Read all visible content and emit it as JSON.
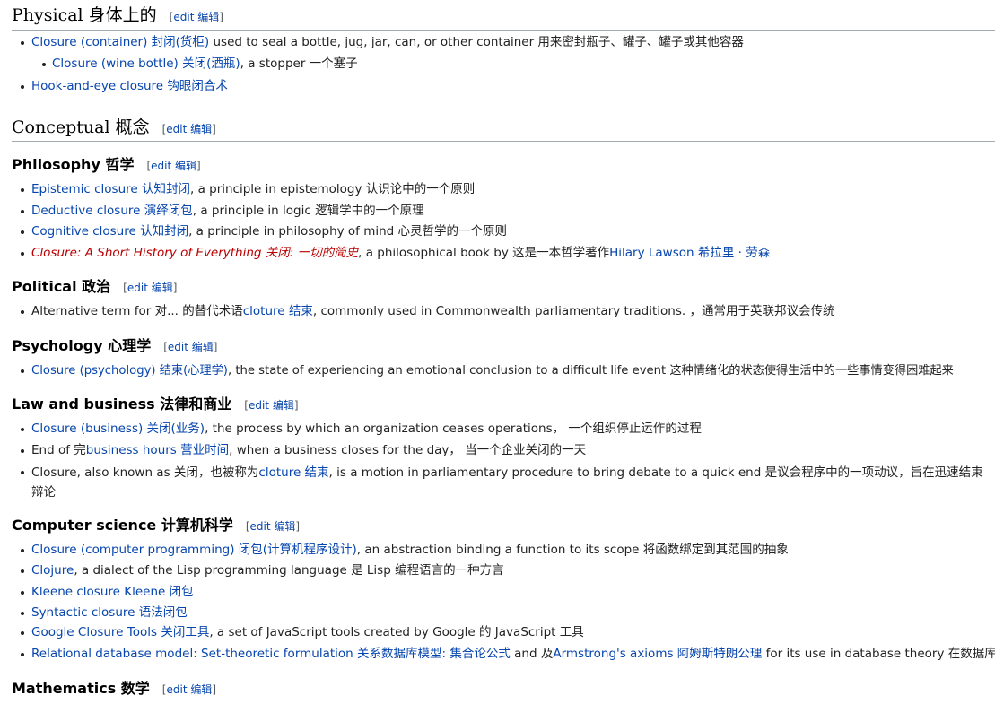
{
  "edit": {
    "open": "[",
    "label": "edit 编辑",
    "close": "]"
  },
  "physical": {
    "title": "Physical 身体上的",
    "items": [
      {
        "link": "Closure (container) 封闭(货柜)",
        "text": " used to seal a bottle, jug, jar, can, or other container 用来密封瓶子、罐子、罐子或其他容器"
      },
      {
        "link": "Closure (wine bottle) 关闭(酒瓶)",
        "text": ", a stopper 一个塞子"
      },
      {
        "link": "Hook-and-eye closure 钩眼闭合术",
        "text": ""
      }
    ]
  },
  "conceptual": {
    "title": "Conceptual 概念"
  },
  "philosophy": {
    "title": "Philosophy 哲学",
    "items": [
      {
        "link": "Epistemic closure 认知封闭",
        "text": ", a principle in epistemology 认识论中的一个原则"
      },
      {
        "link": "Deductive closure 演绎闭包",
        "text": ", a principle in logic 逻辑学中的一个原理"
      },
      {
        "link": "Cognitive closure 认知封闭",
        "text": ", a principle in philosophy of mind 心灵哲学的一个原则"
      },
      {
        "link": "Closure: A Short History of Everything 关闭: 一切的简史",
        "text": ", a philosophical book by 这是一本哲学著作",
        "link2": "Hilary Lawson 希拉里 · 劳森"
      }
    ]
  },
  "political": {
    "title": "Political 政治",
    "items": [
      {
        "pre": "Alternative term for 对... 的替代术语",
        "link": "cloture 结束",
        "text": ", commonly used in Commonwealth parliamentary traditions. ，通常用于英联邦议会传统"
      }
    ]
  },
  "psychology": {
    "title": "Psychology 心理学",
    "items": [
      {
        "link": "Closure (psychology) 结束(心理学)",
        "text": ", the state of experiencing an emotional conclusion to a difficult life event 这种情绪化的状态使得生活中的一些事情变得困难起来"
      }
    ]
  },
  "law": {
    "title": "Law and business 法律和商业",
    "items": [
      {
        "link": "Closure (business) 关闭(业务)",
        "text": ", the process by which an organization ceases operations， 一个组织停止运作的过程"
      },
      {
        "pre": "End of 完",
        "link": "business hours 营业时间",
        "text": ", when a business closes for the day， 当一个企业关闭的一天"
      },
      {
        "pre": "Closure, also known as 关闭，也被称为",
        "link": "cloture 结束",
        "text": ", is a motion in parliamentary procedure to bring debate to a quick end 是议会程序中的一项动议，旨在迅速结束辩论"
      }
    ]
  },
  "cs": {
    "title": "Computer science 计算机科学",
    "items": [
      {
        "link": "Closure (computer programming) 闭包(计算机程序设计)",
        "text": ", an abstraction binding a function to its scope 将函数绑定到其范围的抽象"
      },
      {
        "link": "Clojure",
        "text": ", a dialect of the Lisp programming language 是 Lisp 编程语言的一种方言"
      },
      {
        "link": "Kleene closure Kleene 闭包",
        "text": ""
      },
      {
        "link": "Syntactic closure 语法闭包",
        "text": ""
      },
      {
        "link": "Google Closure Tools 关闭工具",
        "text": ", a set of JavaScript tools created by Google 的 JavaScript 工具"
      },
      {
        "link": "Relational database model: Set-theoretic formulation 关系数据库模型: 集合论公式",
        "text": " and 及",
        "link2": "Armstrong's axioms 阿姆斯特朗公理",
        "text2": " for its use in database theory 在数据库"
      }
    ]
  },
  "math": {
    "title": "Mathematics 数学"
  }
}
